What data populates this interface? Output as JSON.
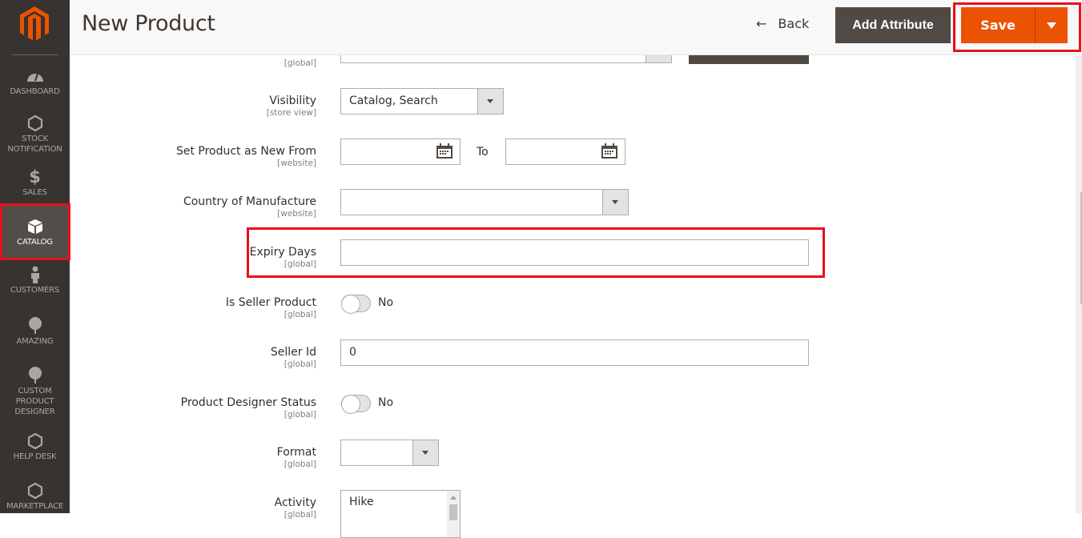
{
  "sidebar": {
    "logo": "magento-logo",
    "items": [
      {
        "label": "DASHBOARD",
        "icon": "dashboard-gauge-icon"
      },
      {
        "label": "STOCK NOTIFICATION",
        "icon": "hexagon-icon"
      },
      {
        "label": "SALES",
        "icon": "dollar-icon"
      },
      {
        "label": "CATALOG",
        "icon": "box-icon",
        "active": true
      },
      {
        "label": "CUSTOMERS",
        "icon": "person-icon"
      },
      {
        "label": "AMAZING",
        "icon": "tree-icon"
      },
      {
        "label": "CUSTOM PRODUCT DESIGNER",
        "icon": "tree-icon"
      },
      {
        "label": "HELP DESK",
        "icon": "hexagon-icon"
      },
      {
        "label": "MARKETPLACE",
        "icon": "hexagon-icon"
      }
    ]
  },
  "header": {
    "title": "New Product",
    "back_label": "Back",
    "add_attribute_label": "Add Attribute",
    "save_label": "Save"
  },
  "form": {
    "partial_row": {
      "scope": "[global]"
    },
    "visibility": {
      "label": "Visibility",
      "scope": "[store view]",
      "value": "Catalog, Search"
    },
    "new_from": {
      "label": "Set Product as New From",
      "scope": "[website]",
      "from_value": "",
      "to_label": "To",
      "to_value": ""
    },
    "country": {
      "label": "Country of Manufacture",
      "scope": "[website]",
      "value": ""
    },
    "expiry_days": {
      "label": "Expiry Days",
      "scope": "[global]",
      "value": ""
    },
    "is_seller_product": {
      "label": "Is Seller Product",
      "scope": "[global]",
      "value": "No",
      "checked": false
    },
    "seller_id": {
      "label": "Seller Id",
      "scope": "[global]",
      "value": "0"
    },
    "designer_status": {
      "label": "Product Designer Status",
      "scope": "[global]",
      "value": "No",
      "checked": false
    },
    "format": {
      "label": "Format",
      "scope": "[global]",
      "value": ""
    },
    "activity": {
      "label": "Activity",
      "scope": "[global]",
      "options": [
        "Hike"
      ]
    }
  },
  "colors": {
    "accent": "#eb5202",
    "sidebar_bg": "#373330",
    "highlight": "#e8101a",
    "button_dark": "#514943"
  }
}
